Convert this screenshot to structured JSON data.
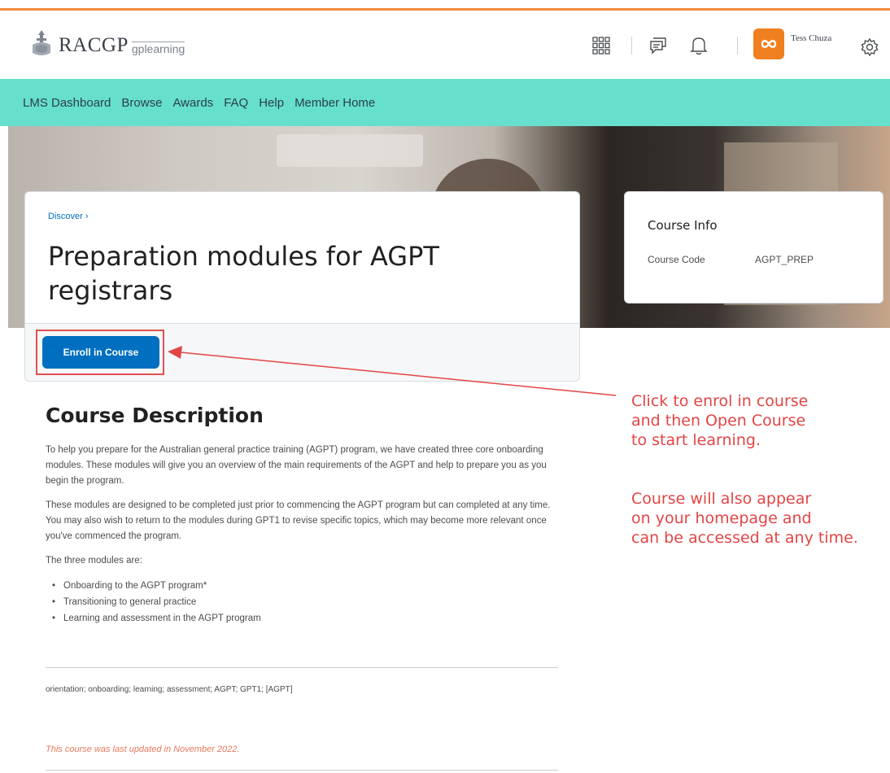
{
  "header": {
    "logo_text": "RACGP",
    "logo_sub": "gplearning",
    "user_name": "Tess Chuza"
  },
  "nav": {
    "items": [
      "LMS Dashboard",
      "Browse",
      "Awards",
      "FAQ",
      "Help",
      "Member Home"
    ]
  },
  "course": {
    "breadcrumb": "Discover  ›",
    "title": "Preparation modules for AGPT registrars",
    "enrol_label": "Enroll in Course"
  },
  "info": {
    "title": "Course Info",
    "code_label": "Course Code",
    "code_value": "AGPT_PREP"
  },
  "description": {
    "heading": "Course Description",
    "p1": "To help you prepare for the Australian general practice training (AGPT) program, we have created three core onboarding modules. These modules will give you an overview of the main requirements of the AGPT and help to prepare you as you begin the program.",
    "p2": "These modules are designed to be completed just prior to commencing the AGPT program but can completed at any time. You may also wish to return to the modules during GPT1 to revise specific topics, which may become more relevant once you've commenced the program.",
    "p3": "The three modules are:",
    "modules": [
      "Onboarding to the AGPT program*",
      "Transitioning to general practice",
      "Learning and assessment in the AGPT program"
    ],
    "tags": "orientation; onboarding; learning; assessment; AGPT; GPT1; [AGPT]",
    "updated": "This course was last updated in November 2022."
  },
  "annotation": {
    "line1": "Click to enrol in course\nand then Open Course\nto start learning.",
    "line2": "Course will also appear\non your homepage and\ncan be accessed at any time.",
    "color": "#e34545"
  },
  "colors": {
    "accent_top": "#f28a3c",
    "nav_bg": "#66e0cd",
    "button": "#006fbf",
    "avatar": "#f0801f"
  }
}
